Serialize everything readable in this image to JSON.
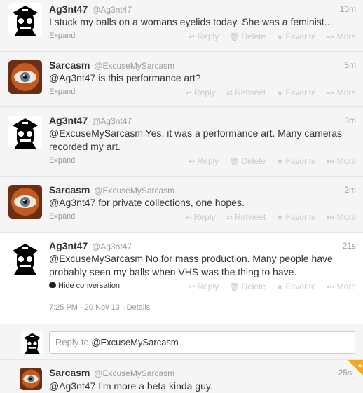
{
  "tweets": [
    {
      "name": "Ag3nt47",
      "handle": "@Ag3nt47",
      "time": "10m",
      "text": "I stuck my balls on a womans eyelids today. She was a feminist...",
      "expand": "Expand",
      "actions": {
        "reply": "Reply",
        "delete": "Delete",
        "favorite": "Favorite",
        "more": "More"
      }
    },
    {
      "name": "Sarcasm",
      "handle": "@ExcuseMySarcasm",
      "time": "5m",
      "mention": "@Ag3nt47",
      "text": " is this performance art?",
      "expand": "Expand",
      "actions": {
        "reply": "Reply",
        "retweet": "Retweet",
        "favorite": "Favorite",
        "more": "More"
      }
    },
    {
      "name": "Ag3nt47",
      "handle": "@Ag3nt47",
      "time": "3m",
      "mention": "@ExcuseMySarcasm",
      "text": " Yes, it was a performance art. Many cameras recorded my art.",
      "expand": "Expand",
      "actions": {
        "reply": "Reply",
        "delete": "Delete",
        "favorite": "Favorite",
        "more": "More"
      }
    },
    {
      "name": "Sarcasm",
      "handle": "@ExcuseMySarcasm",
      "time": "2m",
      "mention": "@Ag3nt47",
      "text": " for private collections, one hopes.",
      "expand": "Expand",
      "actions": {
        "reply": "Reply",
        "retweet": "Retweet",
        "favorite": "Favorite",
        "more": "More"
      }
    },
    {
      "name": "Ag3nt47",
      "handle": "@Ag3nt47",
      "time": "21s",
      "mention": "@ExcuseMySarcasm",
      "text": " No for mass production. Many people have probably seen my balls when VHS was the thing to have.",
      "hide": "Hide conversation",
      "meta": "7:25 PM - 20 Nov 13 · Details",
      "actions": {
        "reply": "Reply",
        "delete": "Delete",
        "favorite": "Favorite",
        "more": "More"
      }
    },
    {
      "name": "Sarcasm",
      "handle": "@ExcuseMySarcasm",
      "time": "25s",
      "mention": "@Ag3nt47",
      "text": " I'm more a beta kinda guy."
    }
  ],
  "reply_box": {
    "prefix": "Reply to ",
    "target": "@ExcuseMySarcasm"
  },
  "icons": [
    "reply-icon",
    "delete-icon",
    "retweet-icon",
    "favorite-icon",
    "more-icon",
    "conversation-icon",
    "favorited-star-icon"
  ],
  "colors": {
    "muted": "#999999",
    "action": "#cccccc",
    "favorite_badge": "#f5a623"
  }
}
